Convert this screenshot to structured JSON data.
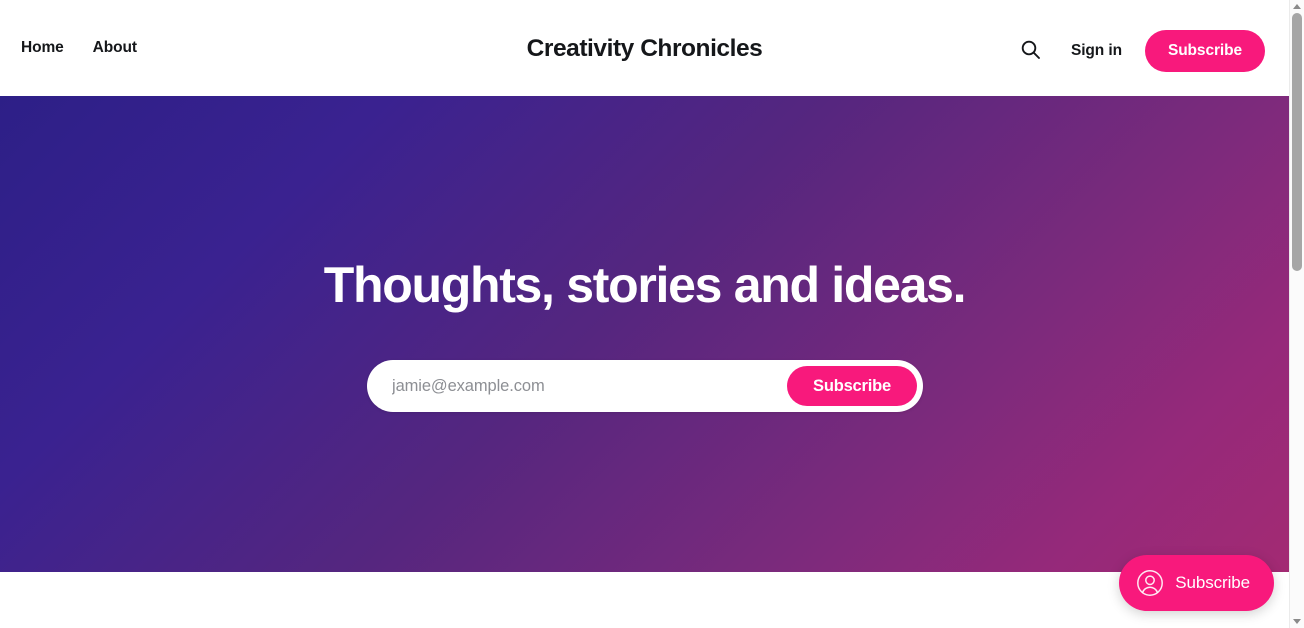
{
  "header": {
    "nav": [
      {
        "label": "Home"
      },
      {
        "label": "About"
      }
    ],
    "title": "Creativity Chronicles",
    "search_icon": "search-icon",
    "signin_label": "Sign in",
    "subscribe_label": "Subscribe"
  },
  "hero": {
    "headline": "Thoughts, stories and ideas.",
    "form": {
      "email_placeholder": "jamie@example.com",
      "email_value": "",
      "submit_label": "Subscribe"
    }
  },
  "portal": {
    "label": "Subscribe",
    "icon": "user-circle-icon"
  },
  "scrollbar": {
    "up_icon": "triangle-up-icon",
    "down_icon": "triangle-down-icon"
  },
  "colors": {
    "accent_pink": "#f8197c",
    "text_dark": "#15171a",
    "placeholder_gray": "#8d8f94",
    "hero_gradient_start": "#2d1f87",
    "hero_gradient_end": "#a32a73"
  }
}
